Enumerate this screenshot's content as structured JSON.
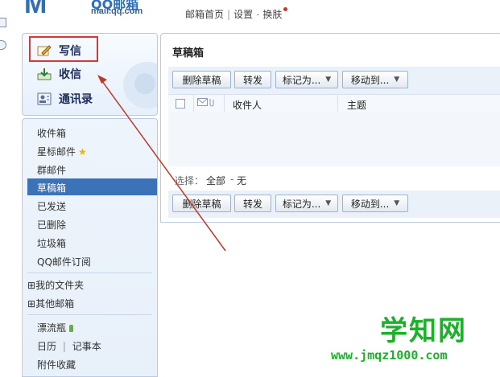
{
  "header": {
    "logo_name": "QQ邮箱",
    "logo_url": "mail.qq.com",
    "links": [
      "邮箱首页",
      "设置",
      "换肤"
    ]
  },
  "sidebar": {
    "write": "写信",
    "receive": "收信",
    "contacts": "通讯录",
    "folders": [
      "收件箱",
      "星标邮件",
      "群邮件",
      "草稿箱",
      "已发送",
      "已删除",
      "垃圾箱",
      "QQ邮件订阅"
    ],
    "active_folder": "草稿箱",
    "groups": [
      "我的文件夹",
      "其他邮箱"
    ],
    "expand_symbol": "⊞",
    "drift_bottle": "漂流瓶",
    "calendar": "日历",
    "notebook": "记事本",
    "attachments": "附件收藏"
  },
  "main": {
    "title": "草稿箱",
    "toolbar": {
      "delete_draft": "删除草稿",
      "forward": "转发",
      "mark_as": "标记为...",
      "move_to": "移动到..."
    },
    "columns": {
      "recipient": "收件人",
      "subject": "主题"
    },
    "select": {
      "label": "选择：",
      "all": "全部",
      "sep": "-",
      "none": "无"
    }
  },
  "watermark": {
    "brand": "学知网",
    "url": "www.jmqz1000.com"
  },
  "colors": {
    "accent_blue": "#3b72b8",
    "highlight_red": "#d23a3a",
    "watermark_green": "#1db02a"
  }
}
